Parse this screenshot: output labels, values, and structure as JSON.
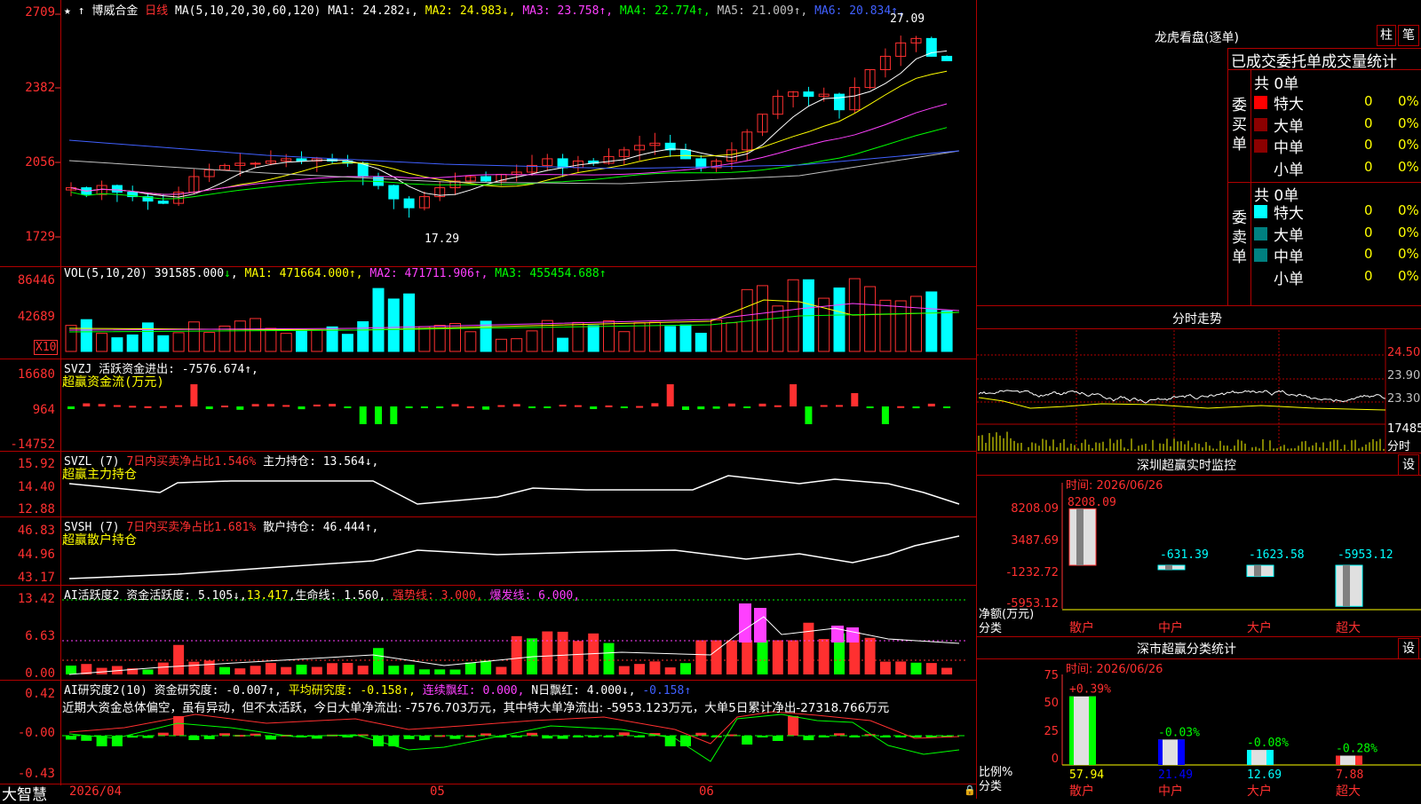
{
  "stock": {
    "name": "博威合金",
    "period": "日线",
    "ma_params": "MA(5,10,20,30,60,120)",
    "ma": [
      {
        "label": "MA1:",
        "value": "24.282",
        "arrow": "↓",
        "color": "#ffffff"
      },
      {
        "label": "MA2:",
        "value": "24.983",
        "arrow": "↓",
        "color": "#ffff00"
      },
      {
        "label": "MA3:",
        "value": "23.758",
        "arrow": "↑",
        "color": "#ff40ff"
      },
      {
        "label": "MA4:",
        "value": "22.774",
        "arrow": "↑",
        "color": "#00ff00"
      },
      {
        "label": "MA5:",
        "value": "21.009",
        "arrow": "↑",
        "color": "#c0c0c0"
      },
      {
        "label": "MA6:",
        "value": "20.834",
        "arrow": "↑",
        "color": "#4060ff"
      }
    ],
    "price_axis": [
      "2709",
      "2382",
      "2056",
      "1729"
    ],
    "high_label": "27.09",
    "low_label": "17.29"
  },
  "vol": {
    "params": "VOL(5,10,20)",
    "value": "391585.000",
    "arrow": "↓",
    "ma1": "MA1: 471664.000↑,",
    "ma2": "MA2: 471711.906↑,",
    "ma3": "MA3: 455454.688↑",
    "axis": [
      "86446",
      "42689"
    ],
    "unit": "X10"
  },
  "svzj": {
    "title": "SVZJ  活跃资金进出: -7576.674↑,",
    "subtitle": "超赢资金流(万元)",
    "axis": [
      "16680",
      "964",
      "-14752"
    ]
  },
  "svzl": {
    "prefix": "SVZL (7) ",
    "ratio": "7日内买卖净占比1.546%",
    "hold": " 主力持仓: 13.564↓,",
    "subtitle": "超赢主力持仓",
    "axis": [
      "15.92",
      "14.40",
      "12.88"
    ]
  },
  "svsh": {
    "prefix": "SVSH (7) ",
    "ratio": "7日内买卖净占比1.681%",
    "hold": " 散户持仓: 46.444↑,",
    "subtitle": "超赢散户持仓",
    "axis": [
      "46.83",
      "44.96",
      "43.17"
    ]
  },
  "ai_active": {
    "prefix": "AI活跃度2 资金活跃度: 5.105↓,",
    "v2": "13.417",
    "life": ",生命线: 1.560,",
    "strong": " 强势线: 3.000,",
    "burst": " 爆发线: 6.000,",
    "axis": [
      "13.42",
      "6.63",
      "0.00"
    ]
  },
  "ai_research": {
    "prefix": "AI研究度2(10) 资金研究度: -0.007↑,",
    "avg": " 平均研究度: -0.158↑,",
    "lianxu": " 连续飘红: 0.000,",
    "nday": " N日飘红: 4.000↓,",
    "tail": " -0.158↑",
    "summary": "近期大资金总体偏空，虽有异动，但不太活跃，今日大单净流出: -7576.703万元，其中特大单净流出: -5953.123万元，大单5日累计净出-27318.766万元",
    "axis": [
      "0.42",
      "-0.00",
      "-0.43"
    ]
  },
  "bottom": {
    "brand": "大智慧",
    "date": "2026/04",
    "months": [
      "05",
      "06"
    ]
  },
  "right": {
    "lhb_title": "龙虎看盘(逐单)",
    "btn_zhu": "柱",
    "btn_bi": "笔",
    "table_header": "已成交委托单成交量统计",
    "buy_side": "委买单",
    "sell_side": "委卖单",
    "buy_total": "共 0单",
    "sell_total": "共 0单",
    "rows": [
      {
        "label": "特大",
        "count": "0",
        "pct": "0%"
      },
      {
        "label": "大单",
        "count": "0",
        "pct": "0%"
      },
      {
        "label": "中单",
        "count": "0",
        "pct": "0%"
      },
      {
        "label": "小单",
        "count": "0",
        "pct": "0%"
      }
    ],
    "fenshi_title": "分时走势",
    "fenshi_axis": [
      "24.50",
      "23.90",
      "23.30",
      "17485"
    ],
    "fenshi_unit": "分时",
    "monitor_title": "深圳超赢实时监控",
    "monitor_btn": "设",
    "monitor_time": "时间: 2026/06/26",
    "monitor_axis": [
      "8208.09",
      "3487.69",
      "-1232.72",
      "-5953.12"
    ],
    "monitor_unit1": "净额(万元)",
    "monitor_unit2": "分类",
    "classify_title": "深市超赢分类统计",
    "classify_btn": "设",
    "classify_time": "时间: 2026/06/26",
    "classify_axis": [
      "75",
      "50",
      "25",
      "0"
    ],
    "classify_unit1": "比例%",
    "classify_unit2": "分类",
    "categories": [
      "散户",
      "中户",
      "大户",
      "超大"
    ],
    "monitor_values": [
      "8208.09",
      "-631.39",
      "-1623.58",
      "-5953.12"
    ],
    "classify_pcts": [
      "+0.39%",
      "-0.03%",
      "-0.08%",
      "-0.28%"
    ],
    "classify_values": [
      "57.94",
      "21.49",
      "12.69",
      "7.88"
    ]
  },
  "colors": {
    "up": "#ff3030",
    "down": "#00ffff",
    "grid": "#b00000",
    "bg": "#000000"
  }
}
